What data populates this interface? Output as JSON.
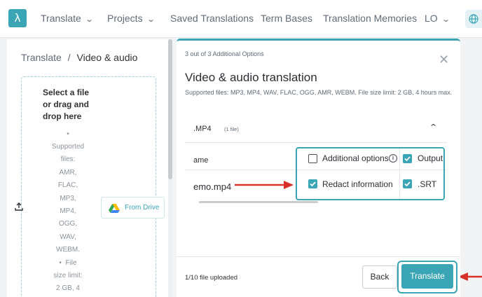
{
  "nav": {
    "logo_glyph": "λ",
    "items": [
      {
        "label": "Translate",
        "dropdown": true
      },
      {
        "label": "Projects",
        "dropdown": true
      },
      {
        "label": "Saved Translations",
        "dropdown": false
      },
      {
        "label": "Term Bases",
        "dropdown": false
      },
      {
        "label": "Translation Memories",
        "dropdown": false
      },
      {
        "label": "LO",
        "dropdown": true
      }
    ],
    "globe_icon": "globe-icon"
  },
  "breadcrumb": {
    "root": "Translate",
    "separator": "/",
    "current": "Video & audio"
  },
  "dropzone": {
    "title": "Select a file or drag and drop here",
    "bullet": "•",
    "supported_lines": [
      "Supported",
      "files:",
      "AMR,",
      "FLAC,",
      "MP3,",
      "MP4,",
      "OGG,",
      "WAV,",
      "WEBM."
    ],
    "limit_lines": [
      "File",
      "size limit:",
      "2 GB, 4"
    ],
    "upload_icon": "upload-icon",
    "drive_label": "From Drive"
  },
  "modal": {
    "step": "3 out of 3 Additional Options",
    "title": "Video & audio translation",
    "supported": "Supported files: MP3, MP4, WAV, FLAC, OGG, AMR, WEBM. File size limit: 2 GB, 4 hours max.",
    "section": {
      "format": ".MP4",
      "count": "(1 file)"
    },
    "table": {
      "name_header": "ame",
      "file": "emo.mp4"
    },
    "options": {
      "additional_options": {
        "label": "Additional options",
        "checked": false
      },
      "output": {
        "label": "Output",
        "checked": true
      },
      "redact": {
        "label": "Redact information",
        "checked": true
      },
      "srt": {
        "label": ".SRT",
        "checked": true
      }
    },
    "footer": {
      "uploaded": "1/10 file uploaded",
      "back": "Back",
      "translate": "Translate"
    }
  },
  "colors": {
    "accent": "#3aa5b5",
    "arrow": "#d9302a"
  }
}
